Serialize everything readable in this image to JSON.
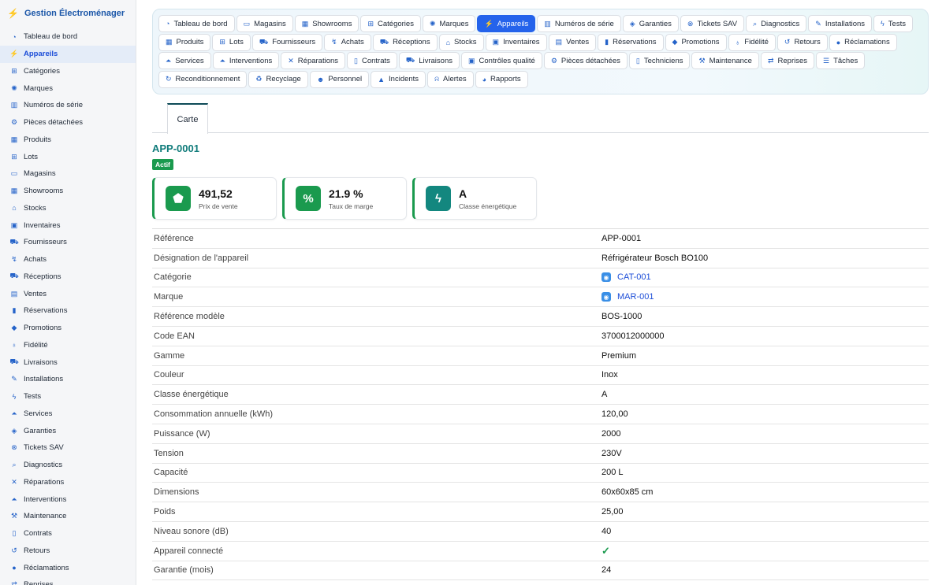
{
  "app": {
    "title": "Gestion Électroménager",
    "icon": "plug-icon"
  },
  "sidebar": {
    "items": [
      {
        "label": "Tableau de bord",
        "icon": "dashboard-icon",
        "glyph": "◔"
      },
      {
        "label": "Appareils",
        "icon": "plug-icon",
        "glyph": "⚡",
        "active": true
      },
      {
        "label": "Catégories",
        "icon": "sitemap-icon",
        "glyph": "⊞"
      },
      {
        "label": "Marques",
        "icon": "certificate-icon",
        "glyph": "✺"
      },
      {
        "label": "Numéros de série",
        "icon": "barcode-icon",
        "glyph": "▥"
      },
      {
        "label": "Pièces détachées",
        "icon": "cog-icon",
        "glyph": "⚙"
      },
      {
        "label": "Produits",
        "icon": "boxes-icon",
        "glyph": "▦"
      },
      {
        "label": "Lots",
        "icon": "cubes-icon",
        "glyph": "⊞"
      },
      {
        "label": "Magasins",
        "icon": "store-icon",
        "glyph": "▭"
      },
      {
        "label": "Showrooms",
        "icon": "grid-icon",
        "glyph": "▦"
      },
      {
        "label": "Stocks",
        "icon": "warehouse-icon",
        "glyph": "⌂"
      },
      {
        "label": "Inventaires",
        "icon": "clipboard-check-icon",
        "glyph": "▣"
      },
      {
        "label": "Fournisseurs",
        "icon": "truck-icon",
        "glyph": "⛟"
      },
      {
        "label": "Achats",
        "icon": "dolly-icon",
        "glyph": "↯"
      },
      {
        "label": "Réceptions",
        "icon": "truck-loading-icon",
        "glyph": "⛟"
      },
      {
        "label": "Ventes",
        "icon": "cash-register-icon",
        "glyph": "▤"
      },
      {
        "label": "Réservations",
        "icon": "bookmark-icon",
        "glyph": "▮"
      },
      {
        "label": "Promotions",
        "icon": "tags-icon",
        "glyph": "◆"
      },
      {
        "label": "Fidélité",
        "icon": "award-icon",
        "glyph": "♁"
      },
      {
        "label": "Livraisons",
        "icon": "shipping-fast-icon",
        "glyph": "⛟"
      },
      {
        "label": "Installations",
        "icon": "wrench-icon",
        "glyph": "✎"
      },
      {
        "label": "Tests",
        "icon": "bolt-icon",
        "glyph": "ϟ"
      },
      {
        "label": "Services",
        "icon": "concierge-bell-icon",
        "glyph": "⏶"
      },
      {
        "label": "Garanties",
        "icon": "shield-icon",
        "glyph": "◈"
      },
      {
        "label": "Tickets SAV",
        "icon": "life-ring-icon",
        "glyph": "⊗"
      },
      {
        "label": "Diagnostics",
        "icon": "search-icon",
        "glyph": "⌕"
      },
      {
        "label": "Réparations",
        "icon": "tools-icon",
        "glyph": "✕"
      },
      {
        "label": "Interventions",
        "icon": "hard-hat-icon",
        "glyph": "⏶"
      },
      {
        "label": "Maintenance",
        "icon": "hammer-icon",
        "glyph": "⚒"
      },
      {
        "label": "Contrats",
        "icon": "file-contract-icon",
        "glyph": "▯"
      },
      {
        "label": "Retours",
        "icon": "undo-icon",
        "glyph": "↺"
      },
      {
        "label": "Réclamations",
        "icon": "comment-icon",
        "glyph": "●"
      },
      {
        "label": "Reprises",
        "icon": "exchange-icon",
        "glyph": "⇄"
      }
    ]
  },
  "module_tabs": [
    [
      {
        "label": "Tableau de bord",
        "icon": "dashboard-icon",
        "glyph": "◔"
      },
      {
        "label": "Magasins",
        "icon": "store-icon",
        "glyph": "▭"
      },
      {
        "label": "Showrooms",
        "icon": "grid-icon",
        "glyph": "▦"
      },
      {
        "label": "Catégories",
        "icon": "sitemap-icon",
        "glyph": "⊞"
      },
      {
        "label": "Marques",
        "icon": "certificate-icon",
        "glyph": "✺"
      },
      {
        "label": "Appareils",
        "icon": "plug-icon",
        "glyph": "⚡",
        "active": true
      },
      {
        "label": "Numéros de série",
        "icon": "barcode-icon",
        "glyph": "▥"
      },
      {
        "label": "Garanties",
        "icon": "shield-icon",
        "glyph": "◈"
      },
      {
        "label": "Tickets SAV",
        "icon": "life-ring-icon",
        "glyph": "⊗"
      },
      {
        "label": "Diagnostics",
        "icon": "search-icon",
        "glyph": "⌕"
      },
      {
        "label": "Installations",
        "icon": "wrench-icon",
        "glyph": "✎"
      },
      {
        "label": "Tests",
        "icon": "bolt-icon",
        "glyph": "ϟ"
      }
    ],
    [
      {
        "label": "Produits",
        "icon": "boxes-icon",
        "glyph": "▦"
      },
      {
        "label": "Lots",
        "icon": "cubes-icon",
        "glyph": "⊞"
      },
      {
        "label": "Fournisseurs",
        "icon": "truck-icon",
        "glyph": "⛟"
      },
      {
        "label": "Achats",
        "icon": "dolly-icon",
        "glyph": "↯"
      },
      {
        "label": "Réceptions",
        "icon": "truck-loading-icon",
        "glyph": "⛟"
      },
      {
        "label": "Stocks",
        "icon": "warehouse-icon",
        "glyph": "⌂"
      },
      {
        "label": "Inventaires",
        "icon": "clipboard-check-icon",
        "glyph": "▣"
      },
      {
        "label": "Ventes",
        "icon": "cash-register-icon",
        "glyph": "▤"
      },
      {
        "label": "Réservations",
        "icon": "bookmark-icon",
        "glyph": "▮"
      },
      {
        "label": "Promotions",
        "icon": "tags-icon",
        "glyph": "◆"
      },
      {
        "label": "Fidélité",
        "icon": "award-icon",
        "glyph": "♁"
      },
      {
        "label": "Retours",
        "icon": "undo-icon",
        "glyph": "↺"
      },
      {
        "label": "Réclamations",
        "icon": "comment-icon",
        "glyph": "●"
      }
    ],
    [
      {
        "label": "Services",
        "icon": "concierge-bell-icon",
        "glyph": "⏶"
      },
      {
        "label": "Interventions",
        "icon": "hard-hat-icon",
        "glyph": "⏶"
      },
      {
        "label": "Réparations",
        "icon": "tools-icon",
        "glyph": "✕"
      },
      {
        "label": "Contrats",
        "icon": "file-contract-icon",
        "glyph": "▯"
      },
      {
        "label": "Livraisons",
        "icon": "shipping-fast-icon",
        "glyph": "⛟"
      },
      {
        "label": "Contrôles qualité",
        "icon": "clipboard-check-icon",
        "glyph": "▣"
      },
      {
        "label": "Pièces détachées",
        "icon": "cog-icon",
        "glyph": "⚙"
      },
      {
        "label": "Techniciens",
        "icon": "id-badge-icon",
        "glyph": "▯"
      },
      {
        "label": "Maintenance",
        "icon": "hammer-icon",
        "glyph": "⚒"
      },
      {
        "label": "Reprises",
        "icon": "exchange-icon",
        "glyph": "⇄"
      },
      {
        "label": "Tâches",
        "icon": "list-icon",
        "glyph": "☰"
      }
    ],
    [
      {
        "label": "Reconditionnement",
        "icon": "redo-icon",
        "glyph": "↻"
      },
      {
        "label": "Recyclage",
        "icon": "recycle-icon",
        "glyph": "♻"
      },
      {
        "label": "Personnel",
        "icon": "users-icon",
        "glyph": "☻"
      },
      {
        "label": "Incidents",
        "icon": "warning-icon",
        "glyph": "▲"
      },
      {
        "label": "Alertes",
        "icon": "bell-icon",
        "glyph": "⍾"
      },
      {
        "label": "Rapports",
        "icon": "chart-pie-icon",
        "glyph": "◕"
      }
    ]
  ],
  "view_tabs": {
    "active": "Carte"
  },
  "record": {
    "code": "APP-0001",
    "status": "Actif",
    "status_color": "#1a9a4e"
  },
  "kpis": [
    {
      "value": "491,52",
      "label": "Prix de vente",
      "icon": "tag-icon",
      "glyph": "⬟",
      "color": "#1a9a4e"
    },
    {
      "value": "21.9 %",
      "label": "Taux de marge",
      "icon": "percent-icon",
      "glyph": "%",
      "color": "#1a9a4e"
    },
    {
      "value": "A",
      "label": "Classe énergétique",
      "icon": "bolt-icon",
      "glyph": "ϟ",
      "color": "#13877f"
    }
  ],
  "details": [
    {
      "label": "Référence",
      "value": "APP-0001"
    },
    {
      "label": "Désignation de l'appareil",
      "value": "Réfrigérateur Bosch BO100"
    },
    {
      "label": "Catégorie",
      "value": "CAT-001",
      "link": true,
      "icon": "link-record-icon"
    },
    {
      "label": "Marque",
      "value": "MAR-001",
      "link": true,
      "icon": "link-record-icon"
    },
    {
      "label": "Référence modèle",
      "value": "BOS-1000"
    },
    {
      "label": "Code EAN",
      "value": "3700012000000"
    },
    {
      "label": "Gamme",
      "value": "Premium"
    },
    {
      "label": "Couleur",
      "value": "Inox"
    },
    {
      "label": "Classe énergétique",
      "value": "A"
    },
    {
      "label": "Consommation annuelle (kWh)",
      "value": "120,00"
    },
    {
      "label": "Puissance (W)",
      "value": "2000"
    },
    {
      "label": "Tension",
      "value": "230V"
    },
    {
      "label": "Capacité",
      "value": "200 L"
    },
    {
      "label": "Dimensions",
      "value": "60x60x85 cm"
    },
    {
      "label": "Poids",
      "value": "25,00"
    },
    {
      "label": "Niveau sonore (dB)",
      "value": "40"
    },
    {
      "label": "Appareil connecté",
      "value": "✓",
      "check": true,
      "icon": "check-icon"
    },
    {
      "label": "Garantie (mois)",
      "value": "24"
    }
  ]
}
